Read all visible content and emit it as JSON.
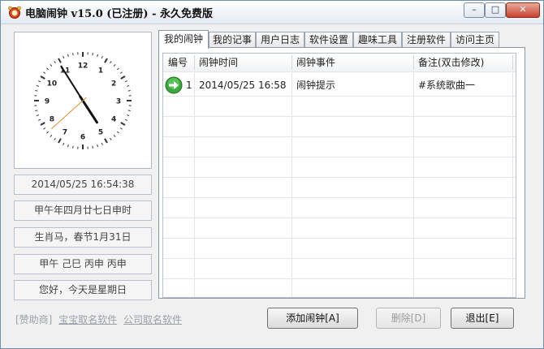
{
  "window": {
    "title": "电脑闹钟 v15.0 (已注册) - 永久免费版",
    "controls": {
      "minimize": "–",
      "maximize": "□",
      "close": "✕"
    }
  },
  "clock": {
    "time": "16:54:38",
    "numbers": [
      "12",
      "1",
      "2",
      "3",
      "4",
      "5",
      "6",
      "7",
      "8",
      "9",
      "10",
      "11"
    ]
  },
  "info": {
    "datetime": "2014/05/25 16:54:38",
    "lunar": "甲午年四月廿七日申时",
    "zodiac": "生肖马，春节1月31日",
    "ganzhi": "甲午 己巳 丙申 丙申",
    "greeting": "您好，今天是星期日"
  },
  "tabs": [
    "我的闹钟",
    "我的记事",
    "用户日志",
    "软件设置",
    "趣味工具",
    "注册软件",
    "访问主页"
  ],
  "table": {
    "headers": [
      "编号",
      "闹钟时间",
      "闹钟事件",
      "备注(双击修改)"
    ],
    "rows": [
      {
        "num": "1",
        "time": "2014/05/25 16:58",
        "event": "闹钟提示",
        "note": "#系统歌曲一",
        "status_icon": "green-arrow-icon"
      }
    ]
  },
  "footer": {
    "sponsor": "[赞助商]",
    "link1": "宝宝取名软件",
    "link2": "公司取名软件"
  },
  "buttons": {
    "add": "添加闹钟[A]",
    "delete": "删除[D]",
    "exit": "退出[E]"
  }
}
